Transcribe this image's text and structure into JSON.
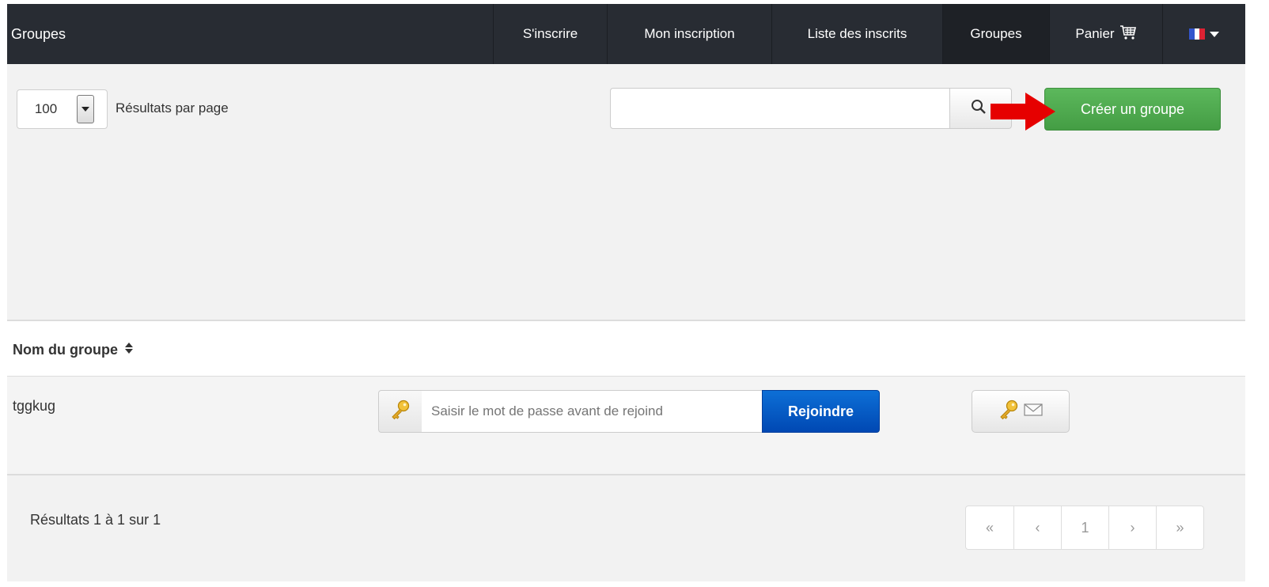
{
  "navbar": {
    "brand": "Groupes",
    "items": [
      {
        "label": "S'inscrire"
      },
      {
        "label": "Mon inscription"
      },
      {
        "label": "Liste des inscrits"
      },
      {
        "label": "Groupes",
        "active": true
      },
      {
        "label": "Panier",
        "icon": "cart-icon"
      }
    ],
    "language_flag": "france-flag-icon",
    "flag_colors": [
      "#3355cc",
      "#ffffff",
      "#dd2233"
    ]
  },
  "controls": {
    "per_page_value": "100",
    "per_page_label": "Résultats par page",
    "search_placeholder": "",
    "create_button": "Créer un groupe"
  },
  "table": {
    "header_name": "Nom du groupe",
    "rows": [
      {
        "name": "tggkug",
        "password_placeholder": "Saisir le mot de passe avant de rejoind",
        "join_button": "Rejoindre"
      }
    ]
  },
  "footer": {
    "results_text": "Résultats 1 à 1 sur 1",
    "pagination": [
      "«",
      "‹",
      "1",
      "›",
      "»"
    ]
  },
  "colors": {
    "navbar": "#282c33",
    "create_button": "#4cae4c",
    "join_button": "#0a5fcf",
    "arrow": "#e60000"
  }
}
